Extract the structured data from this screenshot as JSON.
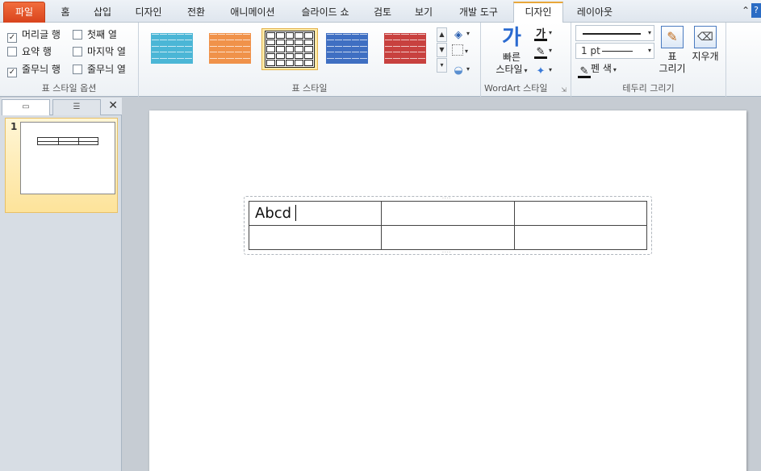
{
  "tabs": [
    "파일",
    "홈",
    "삽입",
    "디자인",
    "전환",
    "애니메이션",
    "슬라이드 쇼",
    "검토",
    "보기",
    "개발 도구",
    "디자인",
    "레이아웃"
  ],
  "active_tab_index": 10,
  "table_style_options": {
    "group_label": "표 스타일 옵션",
    "header_row": {
      "label": "머리글 행",
      "checked": true
    },
    "first_column": {
      "label": "첫째 열",
      "checked": false
    },
    "total_row": {
      "label": "요약 행",
      "checked": false
    },
    "last_column": {
      "label": "마지막 열",
      "checked": false
    },
    "banded_rows": {
      "label": "줄무늬 행",
      "checked": true
    },
    "banded_columns": {
      "label": "줄무늬 열",
      "checked": false
    }
  },
  "table_styles": {
    "group_label": "표 스타일",
    "gallery": [
      {
        "name": "cyan-style",
        "color": "#4bb6d6",
        "selected": false
      },
      {
        "name": "orange-style",
        "color": "#f0924a",
        "selected": false
      },
      {
        "name": "plain-style",
        "color": "#ffffff",
        "selected": true
      },
      {
        "name": "blue-style",
        "color": "#3f6fc2",
        "selected": false
      },
      {
        "name": "red-style",
        "color": "#c8413f",
        "selected": false
      }
    ]
  },
  "wordart": {
    "group_label": "WordArt 스타일",
    "quick_styles_line1": "빠른",
    "quick_styles_line2": "스타일",
    "text_fill_icon": "가"
  },
  "draw_borders": {
    "group_label": "테두리 그리기",
    "pen_weight": "1 pt",
    "pen_color": "펜 색",
    "draw_table_line1": "표",
    "draw_table_line2": "그리기",
    "eraser": "지우개"
  },
  "slides_panel": {
    "slide_number": "1"
  },
  "slide": {
    "cell_text": "Abcd"
  },
  "colors": {
    "file_tab": "#d9431c",
    "active_tab_border": "#e8a73a",
    "selection": "#fde9a8"
  }
}
